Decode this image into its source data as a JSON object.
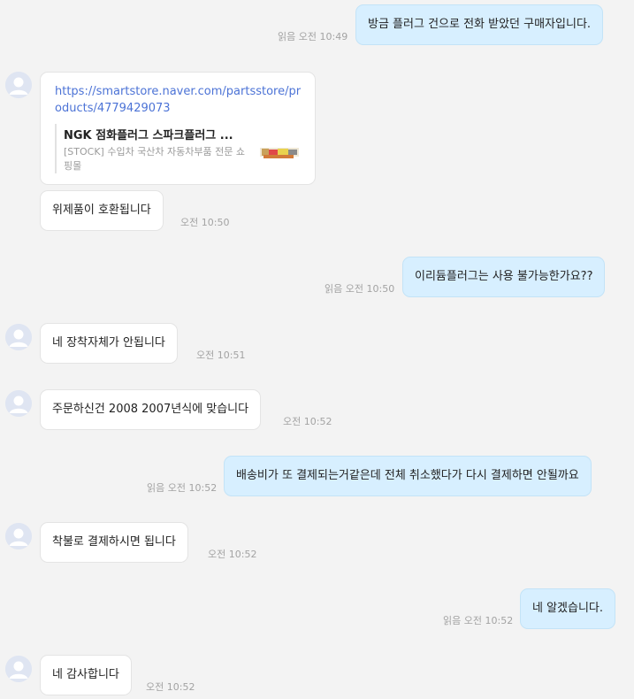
{
  "messages": [
    {
      "text": "방금 플러그 건으로 전화 받았던 구매자입니다.",
      "read": "읽음",
      "time": "오전 10:49"
    },
    {
      "link": "https://smartstore.naver.com/partsstore/products/4779429073",
      "preview_title": "NGK 점화플러그 스파크플러그 ...",
      "preview_desc": "[STOCK] 수입차 국산차 자동차부품 전문 쇼핑몰"
    },
    {
      "text": "위제품이 호환됩니다",
      "time": "오전 10:50"
    },
    {
      "text": "이리듐플러그는 사용 불가능한가요??",
      "read": "읽음",
      "time": "오전 10:50"
    },
    {
      "text": "네 장착자체가 안됩니다",
      "time": "오전 10:51"
    },
    {
      "text": "주문하신건 2008 2007년식에 맞습니다",
      "time": "오전 10:52"
    },
    {
      "text": "배송비가 또 결제되는거같은데 전체 취소했다가 다시 결제하면 안될까요",
      "read": "읽음",
      "time": "오전 10:52"
    },
    {
      "text": "착불로 결제하시면 됩니다",
      "time": "오전 10:52"
    },
    {
      "text": "네 알겠습니다.",
      "read": "읽음",
      "time": "오전 10:52"
    },
    {
      "text": "네 감사합니다",
      "time": "오전 10:52"
    }
  ],
  "colors": {
    "outgoing_bubble": "#d7efff",
    "incoming_bubble": "#ffffff",
    "link": "#4c73d6",
    "meta": "#a3a3a3"
  }
}
